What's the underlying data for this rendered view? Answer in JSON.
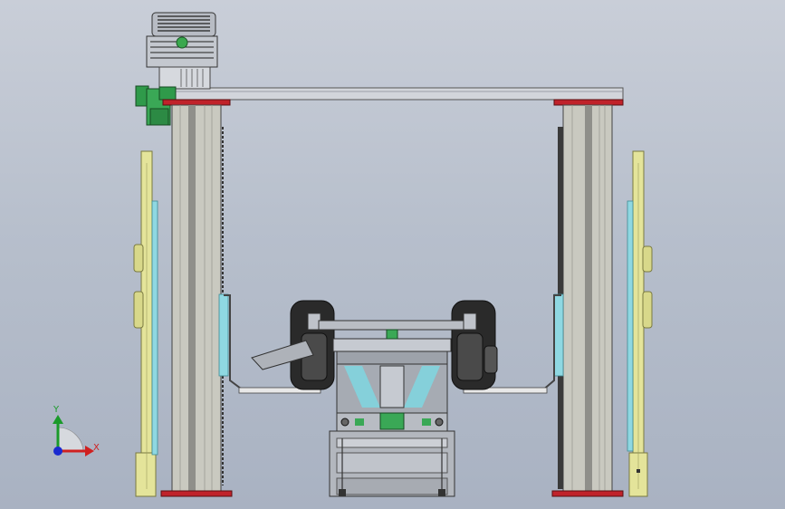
{
  "viewport": {
    "background_top": "#c9ced8",
    "background_bottom": "#a9b2c2"
  },
  "colors": {
    "column_fill": "#c8c8c0",
    "column_shade": "#8e8e8a",
    "rail_fill": "#e6e69a",
    "rail_edge": "#8a8a4a",
    "guide_cyan": "#7fd6e0",
    "red_cap": "#c0222a",
    "motor_green": "#2f9a4a",
    "beam_fill": "#cfd2d8",
    "tire": "#2a2a2a",
    "frame": "#9a9ea6"
  },
  "triad": {
    "y_label": "Y",
    "x_label": "X",
    "y_color": "#1a9a2a",
    "x_color": "#d02020",
    "z_color": "#1a2ad0"
  }
}
